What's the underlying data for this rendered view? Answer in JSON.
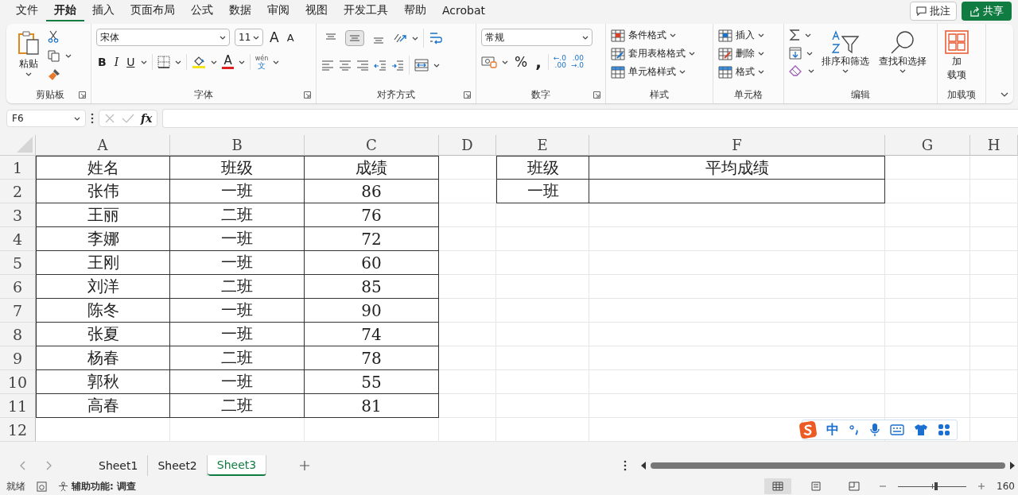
{
  "menu": {
    "tabs": [
      {
        "label": "文件",
        "selected": false
      },
      {
        "label": "开始",
        "selected": true
      },
      {
        "label": "插入",
        "selected": false
      },
      {
        "label": "页面布局",
        "selected": false
      },
      {
        "label": "公式",
        "selected": false
      },
      {
        "label": "数据",
        "selected": false
      },
      {
        "label": "审阅",
        "selected": false
      },
      {
        "label": "视图",
        "selected": false
      },
      {
        "label": "开发工具",
        "selected": false
      },
      {
        "label": "帮助",
        "selected": false
      },
      {
        "label": "Acrobat",
        "selected": false
      }
    ],
    "comment_button": "批注",
    "share_button": "共享"
  },
  "ribbon": {
    "groups": [
      {
        "kind": "clipboard",
        "label": "剪贴板",
        "paste": "粘贴"
      },
      {
        "kind": "font",
        "label": "字体",
        "font_name": "宋体",
        "font_size": "11",
        "grow": "A",
        "shrink": "A",
        "bold": "B",
        "italic": "I",
        "underline": "U",
        "font_color": "A",
        "phonetic_top": "wén",
        "phonetic_bottom": "文"
      },
      {
        "kind": "alignment",
        "label": "对齐方式",
        "vertical_align": [
          {
            "selected": false
          },
          {
            "selected": true
          },
          {
            "selected": false
          }
        ]
      },
      {
        "kind": "number",
        "label": "数字",
        "format": "常规",
        "percent": "%",
        "comma": ",",
        "increase_decimal": [
          "←.0",
          ".00"
        ],
        "decrease_decimal": [
          ".00",
          "→.0"
        ]
      },
      {
        "kind": "styles",
        "label": "样式",
        "buttons": [
          "条件格式",
          "套用表格格式",
          "单元格样式"
        ]
      },
      {
        "kind": "cells",
        "label": "单元格",
        "buttons": [
          "插入",
          "删除",
          "格式"
        ]
      },
      {
        "kind": "editing",
        "label": "编辑",
        "sort": "排序和筛选",
        "find": "查找和选择"
      },
      {
        "kind": "addins",
        "label": "加载项",
        "button_lines": [
          "加",
          "载项"
        ]
      }
    ]
  },
  "formula_bar": {
    "name_box": "F6",
    "fx": "fx"
  },
  "sheet": {
    "columns": [
      "A",
      "B",
      "C",
      "D",
      "E",
      "F",
      "G",
      "H"
    ],
    "row_numbers": [
      "1",
      "2",
      "3",
      "4",
      "5",
      "6",
      "7",
      "8",
      "9",
      "10",
      "11",
      "12"
    ],
    "table_1": {
      "rows": [
        [
          "姓名",
          "班级",
          "成绩"
        ],
        [
          "张伟",
          "一班",
          "86"
        ],
        [
          "王丽",
          "二班",
          "76"
        ],
        [
          "李娜",
          "一班",
          "72"
        ],
        [
          "王刚",
          "一班",
          "60"
        ],
        [
          "刘洋",
          "二班",
          "85"
        ],
        [
          "陈冬",
          "一班",
          "90"
        ],
        [
          "张夏",
          "一班",
          "74"
        ],
        [
          "杨春",
          "二班",
          "78"
        ],
        [
          "郭秋",
          "一班",
          "55"
        ],
        [
          "高春",
          "二班",
          "81"
        ]
      ]
    },
    "table_2": {
      "rows": [
        [
          "班级",
          "平均成绩"
        ],
        [
          "一班"
        ]
      ]
    }
  },
  "ime_toolbar": {
    "mode": "中"
  },
  "sheet_tabs": [
    {
      "label": "Sheet1",
      "selected": false
    },
    {
      "label": "Sheet2",
      "selected": false
    },
    {
      "label": "Sheet3",
      "selected": true
    }
  ],
  "status_bar": {
    "ready": "就绪",
    "accessibility": "辅助功能: 调查",
    "zoom": {
      "level": 0.56,
      "reading": "160"
    }
  }
}
